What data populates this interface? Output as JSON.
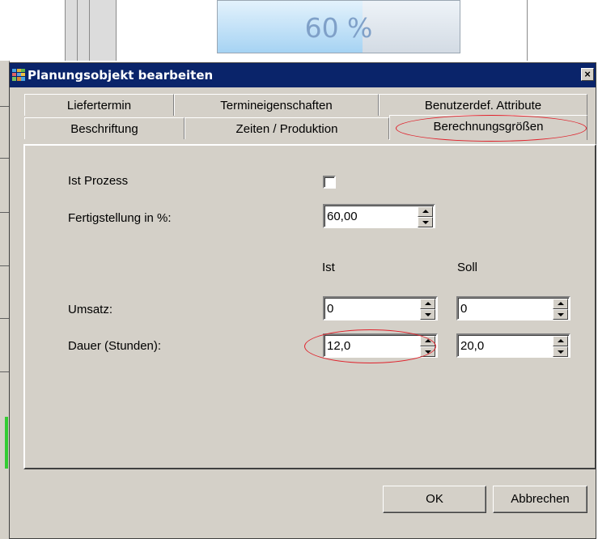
{
  "background": {
    "progress_text": "60 %",
    "progress_fraction": 0.6
  },
  "dialog": {
    "title": "Planungsobjekt bearbeiten",
    "close_glyph": "×",
    "tabs_row1": [
      "Liefertermin",
      "Termineigenschaften",
      "Benutzerdef. Attribute"
    ],
    "tabs_row2": [
      "Beschriftung",
      "Zeiten / Produktion",
      "Berechnungsgrößen"
    ],
    "active_tab": "Berechnungsgrößen",
    "fields": {
      "ist_prozess_label": "Ist Prozess",
      "ist_prozess_checked": false,
      "fertigstellung_label": "Fertigstellung in %:",
      "fertigstellung_value": "60,00",
      "col_ist": "Ist",
      "col_soll": "Soll",
      "umsatz_label": "Umsatz:",
      "umsatz_ist": "0",
      "umsatz_soll": "0",
      "dauer_label": "Dauer (Stunden):",
      "dauer_ist": "12,0",
      "dauer_soll": "20,0"
    },
    "buttons": {
      "ok": "OK",
      "cancel": "Abbrechen"
    },
    "colors": {
      "titlebar": "#0a246a",
      "face": "#d4d0c8",
      "highlight_ellipse": "#e0202a"
    }
  }
}
